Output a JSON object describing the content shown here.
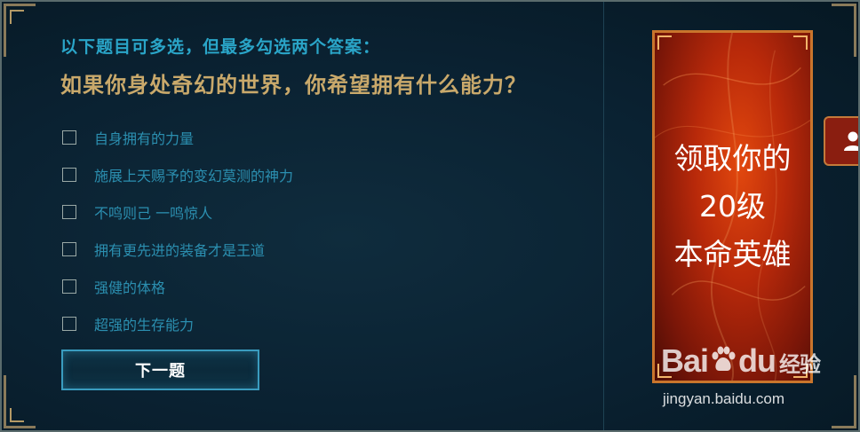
{
  "quiz": {
    "hint": "以下题目可多选，但最多勾选两个答案：",
    "question": "如果你身处奇幻的世界，你希望拥有什么能力？",
    "options": [
      {
        "label": "自身拥有的力量",
        "checked": false
      },
      {
        "label": "施展上天赐予的变幻莫测的神力",
        "checked": false
      },
      {
        "label": "不鸣则己 一鸣惊人",
        "checked": false
      },
      {
        "label": "拥有更先进的装备才是王道",
        "checked": false
      },
      {
        "label": "强健的体格",
        "checked": false
      },
      {
        "label": "超强的生存能力",
        "checked": false
      }
    ],
    "next_button": "下一题"
  },
  "promo": {
    "line1": "领取你的",
    "line2": "20级",
    "line3": "本命英雄"
  },
  "side_tab": {
    "icon": "user-icon"
  },
  "watermark": {
    "logo": "Bai",
    "logo2": "du",
    "jingyan": "经验",
    "url": "jingyan.baidu.com"
  },
  "colors": {
    "hint": "#2aa5c8",
    "question": "#c9a96b",
    "option": "#2b8fb0",
    "button_border": "#3a9cbf",
    "promo_border": "#c9752c"
  }
}
